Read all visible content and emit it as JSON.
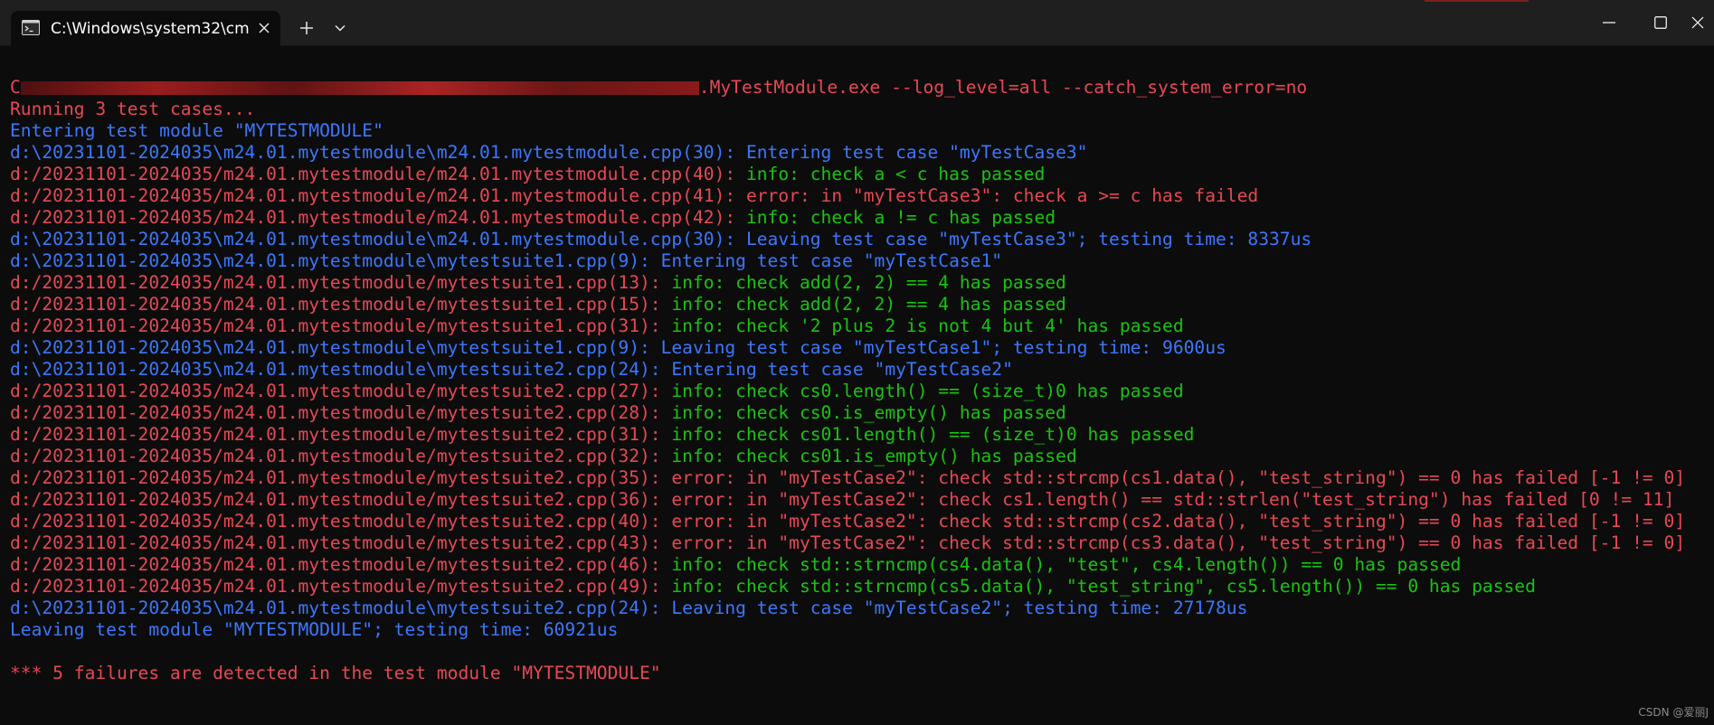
{
  "window": {
    "tab_title": "C:\\Windows\\system32\\cm",
    "tab_icon": "terminal-icon",
    "new_tab_icon": "plus-icon",
    "dropdown_icon": "chevron-down-icon",
    "controls": [
      "minimize-icon",
      "maximize-icon",
      "close-icon"
    ]
  },
  "colors": {
    "background": "#0c0c0c",
    "titlebar": "#1f1f1f",
    "red": "#e74856",
    "blue": "#3b78ff",
    "green": "#16c60c"
  },
  "terminal": {
    "command": {
      "prefix": "C",
      "suffix": ".MyTestModule.exe --log_level=all --catch_system_error=no"
    },
    "running": "Running 3 test cases...",
    "entering_module": "Entering test module \"MYTESTMODULE\"",
    "lines": [
      {
        "src": "d:\\20231101-2024035\\m24.01.mytestmodule\\m24.01.mytestmodule.cpp(30): ",
        "msg": "Entering test case \"myTestCase3\""
      },
      {
        "src": "d:/20231101-2024035/m24.01.mytestmodule/m24.01.mytestmodule.cpp(40): ",
        "msg": "info: check a < c has passed"
      },
      {
        "src": "d:/20231101-2024035/m24.01.mytestmodule/m24.01.mytestmodule.cpp(41): ",
        "msg": "error: in \"myTestCase3\": check a >= c has failed"
      },
      {
        "src": "d:/20231101-2024035/m24.01.mytestmodule/m24.01.mytestmodule.cpp(42): ",
        "msg": "info: check a != c has passed"
      },
      {
        "src": "d:\\20231101-2024035\\m24.01.mytestmodule\\m24.01.mytestmodule.cpp(30): ",
        "msg": "Leaving test case \"myTestCase3\"; testing time: 8337us"
      },
      {
        "src": "d:\\20231101-2024035\\m24.01.mytestmodule\\mytestsuite1.cpp(9): ",
        "msg": "Entering test case \"myTestCase1\""
      },
      {
        "src": "d:/20231101-2024035/m24.01.mytestmodule/mytestsuite1.cpp(13): ",
        "msg": "info: check add(2, 2) == 4 has passed"
      },
      {
        "src": "d:/20231101-2024035/m24.01.mytestmodule/mytestsuite1.cpp(15): ",
        "msg": "info: check add(2, 2) == 4 has passed"
      },
      {
        "src": "d:/20231101-2024035/m24.01.mytestmodule/mytestsuite1.cpp(31): ",
        "msg": "info: check '2 plus 2 is not 4 but 4' has passed"
      },
      {
        "src": "d:\\20231101-2024035\\m24.01.mytestmodule\\mytestsuite1.cpp(9): ",
        "msg": "Leaving test case \"myTestCase1\"; testing time: 9600us"
      },
      {
        "src": "d:\\20231101-2024035\\m24.01.mytestmodule\\mytestsuite2.cpp(24): ",
        "msg": "Entering test case \"myTestCase2\""
      },
      {
        "src": "d:/20231101-2024035/m24.01.mytestmodule/mytestsuite2.cpp(27): ",
        "msg": "info: check cs0.length() == (size_t)0 has passed"
      },
      {
        "src": "d:/20231101-2024035/m24.01.mytestmodule/mytestsuite2.cpp(28): ",
        "msg": "info: check cs0.is_empty() has passed"
      },
      {
        "src": "d:/20231101-2024035/m24.01.mytestmodule/mytestsuite2.cpp(31): ",
        "msg": "info: check cs01.length() == (size_t)0 has passed"
      },
      {
        "src": "d:/20231101-2024035/m24.01.mytestmodule/mytestsuite2.cpp(32): ",
        "msg": "info: check cs01.is_empty() has passed"
      },
      {
        "src": "d:/20231101-2024035/m24.01.mytestmodule/mytestsuite2.cpp(35): ",
        "msg": "error: in \"myTestCase2\": check std::strcmp(cs1.data(), \"test_string\") == 0 has failed [-1 != 0]"
      },
      {
        "src": "d:/20231101-2024035/m24.01.mytestmodule/mytestsuite2.cpp(36): ",
        "msg": "error: in \"myTestCase2\": check cs1.length() == std::strlen(\"test_string\") has failed [0 != 11]"
      },
      {
        "src": "d:/20231101-2024035/m24.01.mytestmodule/mytestsuite2.cpp(40): ",
        "msg": "error: in \"myTestCase2\": check std::strcmp(cs2.data(), \"test_string\") == 0 has failed [-1 != 0]"
      },
      {
        "src": "d:/20231101-2024035/m24.01.mytestmodule/mytestsuite2.cpp(43): ",
        "msg": "error: in \"myTestCase2\": check std::strcmp(cs3.data(), \"test_string\") == 0 has failed [-1 != 0]"
      },
      {
        "src": "d:/20231101-2024035/m24.01.mytestmodule/mytestsuite2.cpp(46): ",
        "msg": "info: check std::strncmp(cs4.data(), \"test\", cs4.length()) == 0 has passed"
      },
      {
        "src": "d:/20231101-2024035/m24.01.mytestmodule/mytestsuite2.cpp(49): ",
        "msg": "info: check std::strncmp(cs5.data(), \"test_string\", cs5.length()) == 0 has passed"
      },
      {
        "src": "d:\\20231101-2024035\\m24.01.mytestmodule\\mytestsuite2.cpp(24): ",
        "msg": "Leaving test case \"myTestCase2\"; testing time: 27178us"
      }
    ],
    "leaving_module": "Leaving test module \"MYTESTMODULE\"; testing time: 60921us",
    "summary": "*** 5 failures are detected in the test module \"MYTESTMODULE\""
  },
  "watermark": "CSDN @爱丽J"
}
